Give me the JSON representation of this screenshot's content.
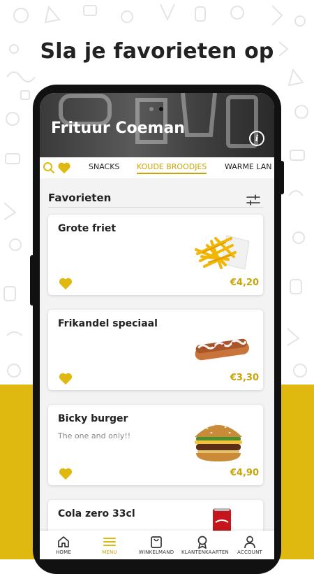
{
  "headline": "Sla je favorieten op",
  "restaurant": {
    "name": "Frituur Coeman"
  },
  "categories": {
    "tabs": [
      {
        "label": "SNACKS"
      },
      {
        "label": "KOUDE BROODJES"
      },
      {
        "label": "WARME LAN"
      }
    ],
    "active_index": 1
  },
  "favorites": {
    "title": "Favorieten",
    "items": [
      {
        "name": "Grote friet",
        "description": "",
        "price": "€4,20",
        "image_icon": "fries-icon"
      },
      {
        "name": "Frikandel speciaal",
        "description": "",
        "price": "€3,30",
        "image_icon": "frikandel-icon"
      },
      {
        "name": "Bicky burger",
        "description": "The one and only!!",
        "price": "€4,90",
        "image_icon": "burger-icon"
      },
      {
        "name": "Cola zero 33cl",
        "description": "",
        "price": "",
        "image_icon": "cola-can-icon"
      }
    ]
  },
  "bottom_nav": {
    "items": [
      {
        "label": "HOME",
        "icon": "home-icon"
      },
      {
        "label": "MENU",
        "icon": "menu-icon"
      },
      {
        "label": "WINKELMAND",
        "icon": "basket-icon"
      },
      {
        "label": "KLANTENKAARTEN",
        "icon": "award-icon"
      },
      {
        "label": "ACCOUNT",
        "icon": "user-icon"
      }
    ],
    "active_index": 1
  },
  "colors": {
    "accent": "#e0b910",
    "accent_text": "#c9a40a",
    "dark": "#111111"
  }
}
